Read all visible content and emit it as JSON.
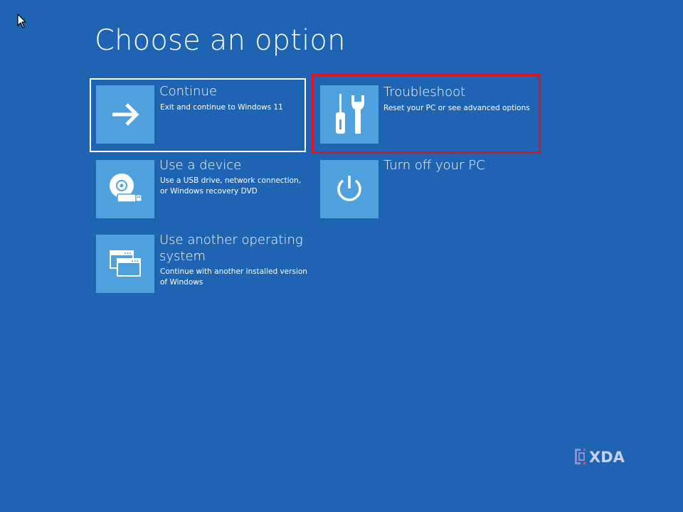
{
  "screen": {
    "title": "Choose an option",
    "background_color": "#1f64b3",
    "tile_icon_color": "#4fa1de",
    "highlight_color": "#e0141c"
  },
  "options": [
    {
      "id": "continue",
      "label": "Continue",
      "description": "Exit and continue to Windows 11",
      "icon": "arrow-right-icon",
      "state": "focused"
    },
    {
      "id": "troubleshoot",
      "label": "Troubleshoot",
      "description": "Reset your PC or see advanced options",
      "icon": "tools-icon",
      "state": "highlighted"
    },
    {
      "id": "use-device",
      "label": "Use a device",
      "description_line1": "Use a USB drive, network connection,",
      "description_line2": "or Windows recovery DVD",
      "icon": "disc-usb-icon"
    },
    {
      "id": "turn-off",
      "label": "Turn off your PC",
      "icon": "power-icon"
    },
    {
      "id": "another-os",
      "label_line1": "Use another operating",
      "label_line2": "system",
      "description_line1": "Continue with another installed version",
      "description_line2": "of Windows",
      "icon": "windows-stack-icon"
    }
  ],
  "watermark": {
    "text": "XDA",
    "icon": "xda-logo-icon"
  }
}
